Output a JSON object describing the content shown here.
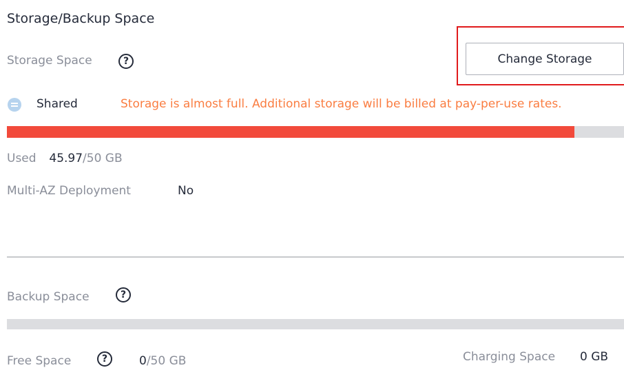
{
  "section": {
    "title": "Storage/Backup Space"
  },
  "storage": {
    "label": "Storage Space",
    "help_icon": "question-circle-icon",
    "change_button": "Change Storage",
    "type_icon": "database-icon",
    "type_label": "Shared",
    "warning": "Storage is almost full. Additional storage will be billed at pay-per-use rates.",
    "usage_fraction": 0.9194,
    "used_label": "Used",
    "used_value": "45.97",
    "used_total": "/50 GB",
    "multi_az_label": "Multi-AZ Deployment",
    "multi_az_value": "No"
  },
  "backup": {
    "label": "Backup Space",
    "help_icon": "question-circle-icon",
    "usage_fraction": 0,
    "free_label": "Free Space",
    "free_value": "0",
    "free_total": "/50 GB",
    "charging_label": "Charging Space",
    "charging_value": "0 GB"
  },
  "colors": {
    "warning": "#fa7d41",
    "usage_bar": "#f24a3b",
    "highlight": "#e0191b"
  }
}
